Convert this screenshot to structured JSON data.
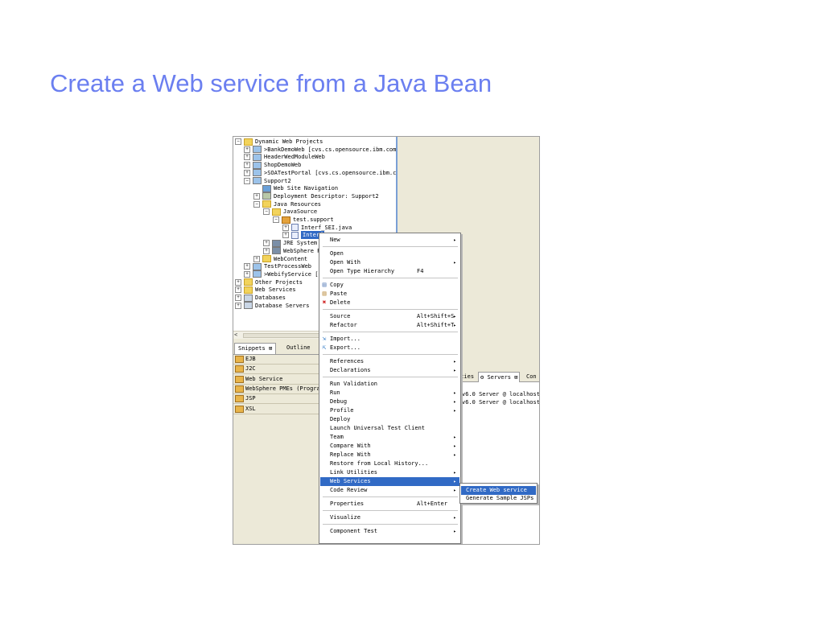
{
  "slide": {
    "title": "Create a Web service from a Java Bean"
  },
  "explorer": {
    "items": [
      {
        "label": "Dynamic Web Projects",
        "expander": "−",
        "icon": "folder"
      },
      {
        "label": ">BankDemoWeb   [cvs.cs.opensource.ibm.com]",
        "expander": "+",
        "icon": "proj"
      },
      {
        "label": "HeaderWedModuleWeb",
        "expander": "+",
        "icon": "proj"
      },
      {
        "label": "ShopDemoWeb",
        "expander": "+",
        "icon": "proj"
      },
      {
        "label": ">SOATestPortal   [cvs.cs.opensource.ibm.com]",
        "expander": "+",
        "icon": "proj"
      },
      {
        "label": "Support2",
        "expander": "−",
        "icon": "proj"
      },
      {
        "label": "Web Site Navigation",
        "expander": "",
        "icon": "site"
      },
      {
        "label": "Deployment Descriptor: Support2",
        "expander": "+",
        "icon": "desc"
      },
      {
        "label": "Java Resources",
        "expander": "−",
        "icon": "folder"
      },
      {
        "label": "JavaSource",
        "expander": "−",
        "icon": "folder"
      },
      {
        "label": "test.support",
        "expander": "−",
        "icon": "pkg"
      },
      {
        "label": "Interf_SEI.java",
        "expander": "+",
        "icon": "java"
      },
      {
        "label": "Interf",
        "expander": "+",
        "icon": "java",
        "selected": true
      },
      {
        "label": "JRE System Li",
        "expander": "+",
        "icon": "lib"
      },
      {
        "label": "WebSphere Pr",
        "expander": "+",
        "icon": "lib"
      },
      {
        "label": "WebContent",
        "expander": "+",
        "icon": "folder"
      },
      {
        "label": "TestProcessWeb",
        "expander": "+",
        "icon": "proj"
      },
      {
        "label": ">WebifyService   [c",
        "expander": "+",
        "icon": "proj"
      },
      {
        "label": "Other Projects",
        "expander": "+",
        "icon": "folder"
      },
      {
        "label": "Web Services",
        "expander": "+",
        "icon": "folder"
      },
      {
        "label": "Databases",
        "expander": "+",
        "icon": "db"
      },
      {
        "label": "Database Servers",
        "expander": "+",
        "icon": "db"
      }
    ]
  },
  "hscroll": {
    "left_arrow": "<"
  },
  "snippets": {
    "tab_label": "Snippets",
    "outline_label": "Outline",
    "close": "⊠"
  },
  "palette": {
    "items": [
      {
        "label": "EJB"
      },
      {
        "label": "J2C"
      },
      {
        "label": "Web Service"
      },
      {
        "label": "WebSphere PMEs (Programmi"
      },
      {
        "label": "JSP"
      },
      {
        "label": "XSL"
      }
    ]
  },
  "servers": {
    "tab_properties": "rties",
    "tab_servers": "Servers",
    "tab_close": "⊠",
    "tab_console": "Con",
    "rows": [
      {
        "label": "v6.0 Server @ localhost"
      },
      {
        "label": "v6.0 Server @ localhost  @"
      }
    ]
  },
  "context_menu": {
    "items": [
      {
        "label": "New",
        "sub": "▸"
      },
      {
        "separator": true
      },
      {
        "label": "Open"
      },
      {
        "label": "Open With",
        "sub": "▸"
      },
      {
        "label": "Open Type Hierarchy",
        "key": "F4"
      },
      {
        "separator": true
      },
      {
        "label": "Copy",
        "icon": "copy-icon"
      },
      {
        "label": "Paste",
        "icon": "paste-icon"
      },
      {
        "label": "Delete",
        "icon": "delete-icon"
      },
      {
        "separator": true
      },
      {
        "label": "Source",
        "key": "Alt+Shift+S",
        "sub": "▸"
      },
      {
        "label": "Refactor",
        "key": "Alt+Shift+T",
        "sub": "▸"
      },
      {
        "separator": true
      },
      {
        "label": "Import...",
        "icon": "import-icon"
      },
      {
        "label": "Export...",
        "icon": "export-icon"
      },
      {
        "separator": true
      },
      {
        "label": "References",
        "sub": "▸"
      },
      {
        "label": "Declarations",
        "sub": "▸"
      },
      {
        "separator": true
      },
      {
        "label": "Run Validation"
      },
      {
        "label": "Run",
        "sub": "▸"
      },
      {
        "label": "Debug",
        "sub": "▸"
      },
      {
        "label": "Profile",
        "sub": "▸"
      },
      {
        "label": "Deploy"
      },
      {
        "label": "Launch Universal Test Client"
      },
      {
        "label": "Team",
        "sub": "▸"
      },
      {
        "label": "Compare With",
        "sub": "▸"
      },
      {
        "label": "Replace With",
        "sub": "▸"
      },
      {
        "label": "Restore from Local History..."
      },
      {
        "label": "Link Utilities",
        "sub": "▸"
      },
      {
        "label": "Web Services",
        "sub": "▸",
        "highlighted": true
      },
      {
        "label": "Code Review",
        "sub": "▸"
      },
      {
        "separator": true
      },
      {
        "label": "Properties",
        "key": "Alt+Enter"
      },
      {
        "separator": true
      },
      {
        "label": "Visualize",
        "sub": "▸"
      },
      {
        "separator": true
      },
      {
        "label": "Component Test",
        "sub": "▸"
      }
    ]
  },
  "submenu": {
    "items": [
      {
        "label": "Create Web service",
        "highlighted": true
      },
      {
        "label": "Generate Sample JSPs"
      }
    ]
  },
  "colors": {
    "title": "#6b7ff0",
    "selection": "#316ac5",
    "panel": "#ece9d8"
  }
}
